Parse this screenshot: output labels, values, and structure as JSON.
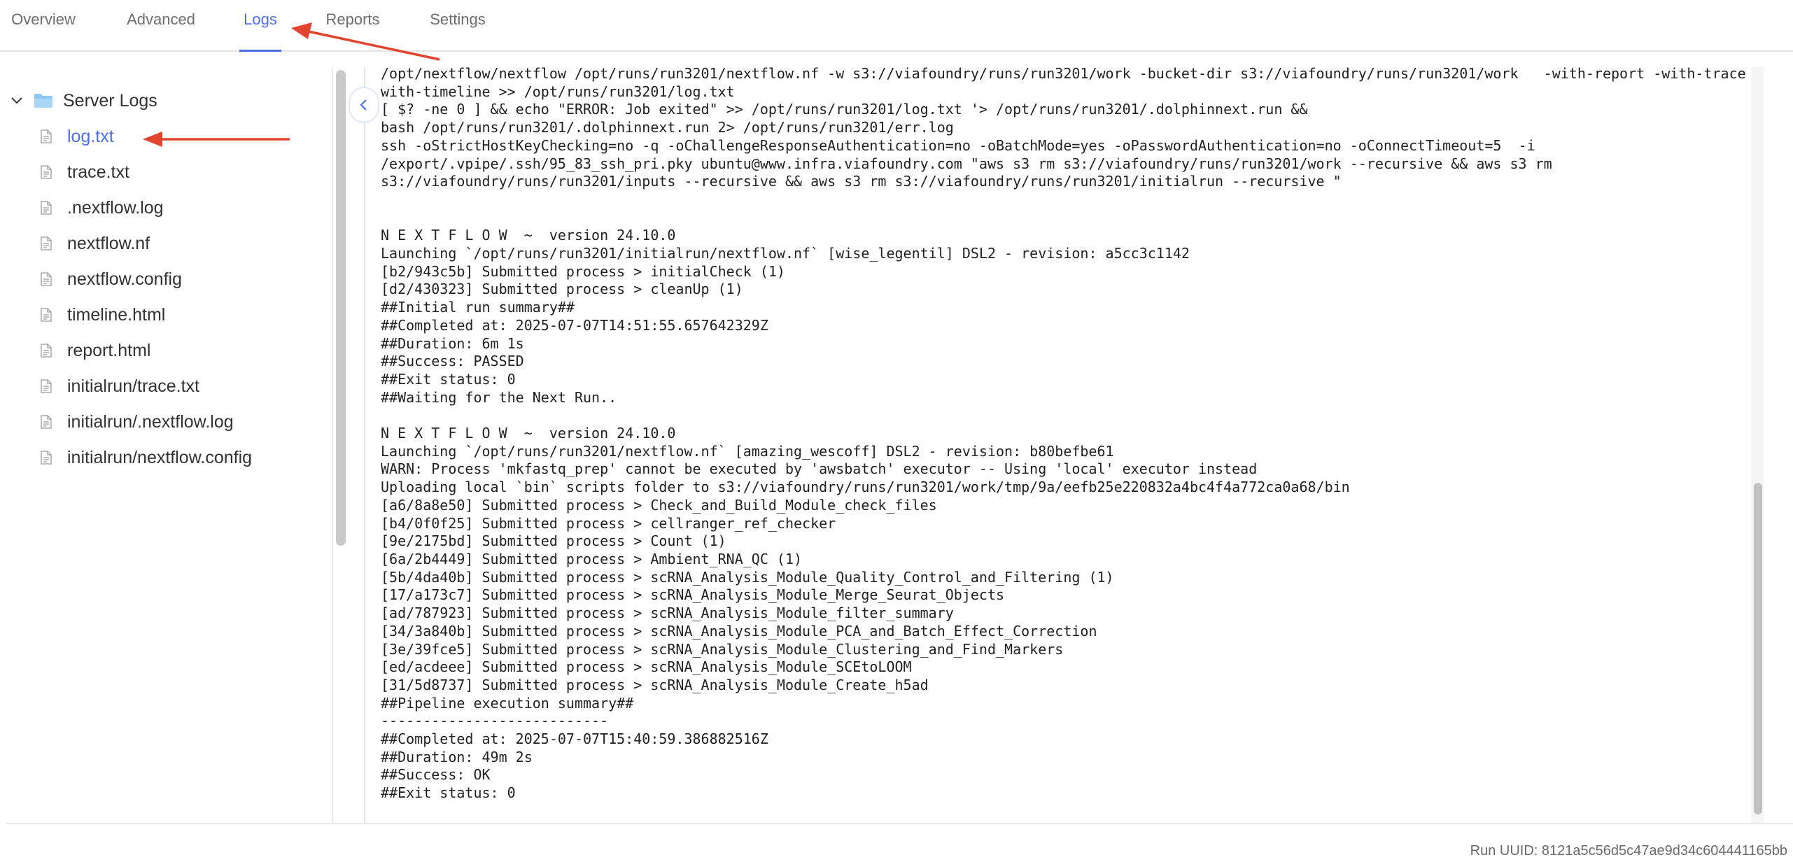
{
  "tabs": [
    {
      "label": "Overview",
      "active": false
    },
    {
      "label": "Advanced",
      "active": false
    },
    {
      "label": "Logs",
      "active": true
    },
    {
      "label": "Reports",
      "active": false
    },
    {
      "label": "Settings",
      "active": false
    }
  ],
  "tree": {
    "root_label": "Server Logs",
    "files": [
      {
        "label": "log.txt",
        "active": true
      },
      {
        "label": "trace.txt"
      },
      {
        "label": ".nextflow.log"
      },
      {
        "label": "nextflow.nf"
      },
      {
        "label": "nextflow.config"
      },
      {
        "label": "timeline.html"
      },
      {
        "label": "report.html"
      },
      {
        "label": "initialrun/trace.txt"
      },
      {
        "label": "initialrun/.nextflow.log"
      },
      {
        "label": "initialrun/nextflow.config"
      }
    ]
  },
  "log_lines": [
    "/opt/nextflow/nextflow /opt/runs/run3201/nextflow.nf -w s3://viafoundry/runs/run3201/work -bucket-dir s3://viafoundry/runs/run3201/work   -with-report -with-trace -",
    "with-timeline >> /opt/runs/run3201/log.txt",
    "[ $? -ne 0 ] && echo \"ERROR: Job exited\" >> /opt/runs/run3201/log.txt '> /opt/runs/run3201/.dolphinnext.run &&",
    "bash /opt/runs/run3201/.dolphinnext.run 2> /opt/runs/run3201/err.log",
    "ssh -oStrictHostKeyChecking=no -q -oChallengeResponseAuthentication=no -oBatchMode=yes -oPasswordAuthentication=no -oConnectTimeout=5  -i",
    "/export/.vpipe/.ssh/95_83_ssh_pri.pky ubuntu@www.infra.viafoundry.com \"aws s3 rm s3://viafoundry/runs/run3201/work --recursive && aws s3 rm",
    "s3://viafoundry/runs/run3201/inputs --recursive && aws s3 rm s3://viafoundry/runs/run3201/initialrun --recursive \"",
    "",
    "",
    "N E X T F L O W  ~  version 24.10.0",
    "Launching `/opt/runs/run3201/initialrun/nextflow.nf` [wise_legentil] DSL2 - revision: a5cc3c1142",
    "[b2/943c5b] Submitted process > initialCheck (1)",
    "[d2/430323] Submitted process > cleanUp (1)",
    "##Initial run summary##",
    "##Completed at: 2025-07-07T14:51:55.657642329Z",
    "##Duration: 6m 1s",
    "##Success: PASSED",
    "##Exit status: 0",
    "##Waiting for the Next Run..",
    "",
    "N E X T F L O W  ~  version 24.10.0",
    "Launching `/opt/runs/run3201/nextflow.nf` [amazing_wescoff] DSL2 - revision: b80befbe61",
    "WARN: Process 'mkfastq_prep' cannot be executed by 'awsbatch' executor -- Using 'local' executor instead",
    "Uploading local `bin` scripts folder to s3://viafoundry/runs/run3201/work/tmp/9a/eefb25e220832a4bc4f4a772ca0a68/bin",
    "[a6/8a8e50] Submitted process > Check_and_Build_Module_check_files",
    "[b4/0f0f25] Submitted process > cellranger_ref_checker",
    "[9e/2175bd] Submitted process > Count (1)",
    "[6a/2b4449] Submitted process > Ambient_RNA_QC (1)",
    "[5b/4da40b] Submitted process > scRNA_Analysis_Module_Quality_Control_and_Filtering (1)",
    "[17/a173c7] Submitted process > scRNA_Analysis_Module_Merge_Seurat_Objects",
    "[ad/787923] Submitted process > scRNA_Analysis_Module_filter_summary",
    "[34/3a840b] Submitted process > scRNA_Analysis_Module_PCA_and_Batch_Effect_Correction",
    "[3e/39fce5] Submitted process > scRNA_Analysis_Module_Clustering_and_Find_Markers",
    "[ed/acdeee] Submitted process > scRNA_Analysis_Module_SCEtoLOOM",
    "[31/5d8737] Submitted process > scRNA_Analysis_Module_Create_h5ad",
    "##Pipeline execution summary##",
    "---------------------------",
    "##Completed at: 2025-07-07T15:40:59.386882516Z",
    "##Duration: 49m 2s",
    "##Success: OK",
    "##Exit status: 0"
  ],
  "footer": {
    "run_uuid": "Run UUID: 8121a5c56d5c47ae9d34c604441165bb"
  },
  "colors": {
    "accent": "#4d6ee8",
    "annotation_arrow": "#e2452f",
    "folder": "#8cc8f0"
  }
}
